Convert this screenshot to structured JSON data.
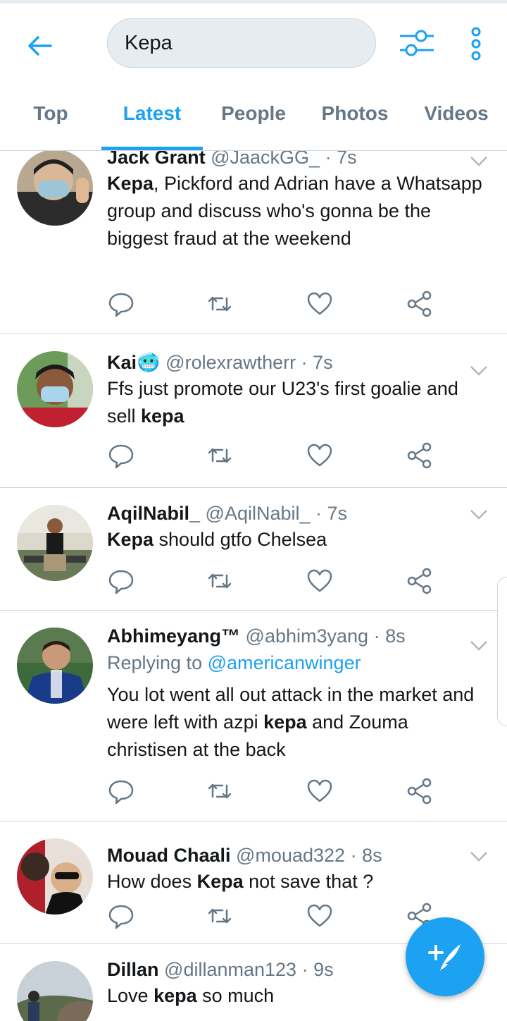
{
  "search": {
    "query": "Kepa"
  },
  "tabs": [
    "Top",
    "Latest",
    "People",
    "Photos",
    "Videos"
  ],
  "active_tab": "Latest",
  "colors": {
    "accent": "#1da1f2",
    "secondary_text": "#657786",
    "divider": "#ccd6dd"
  },
  "tweets": [
    {
      "name": "Jack Grant",
      "handle": "@JaackGG_",
      "time": "· 7s",
      "text": [
        {
          "b": "Kepa"
        },
        {
          "t": ", Pickford and Adrian have a Whatsapp group and discuss who's gonna be the biggest fraud at the weekend"
        }
      ]
    },
    {
      "name": "Kai",
      "emoji": "🥶",
      "handle": "@rolexrawtherr",
      "time": "· 7s",
      "text": [
        {
          "t": "Ffs just promote our U23's first goalie and sell "
        },
        {
          "b": "kepa"
        }
      ]
    },
    {
      "name": "AqilNabil_",
      "handle": "@AqilNabil_",
      "time": "· 7s",
      "text": [
        {
          "b": "Kepa"
        },
        {
          "t": " should gtfo Chelsea"
        }
      ]
    },
    {
      "name": "Abhimeyang™",
      "handle": "@abhim3yang",
      "time": "· 8s",
      "replying_prefix": "Replying to ",
      "replying_to": "@americanwinger",
      "text": [
        {
          "t": "You lot went all out attack in the market and were left with azpi "
        },
        {
          "b": "kepa"
        },
        {
          "t": " and Zouma christisen  at the back"
        }
      ]
    },
    {
      "name": "Mouad Chaali",
      "handle": "@mouad322",
      "time": "· 8s",
      "text": [
        {
          "t": "How does "
        },
        {
          "b": "Kepa"
        },
        {
          "t": " not save that ?"
        }
      ]
    },
    {
      "name": "Dillan",
      "handle": "@dillanman123",
      "time": "· 9s",
      "text": [
        {
          "t": "Love "
        },
        {
          "b": "kepa"
        },
        {
          "t": " so much"
        }
      ]
    }
  ],
  "fab": {
    "icon": "compose-tweet-icon"
  }
}
